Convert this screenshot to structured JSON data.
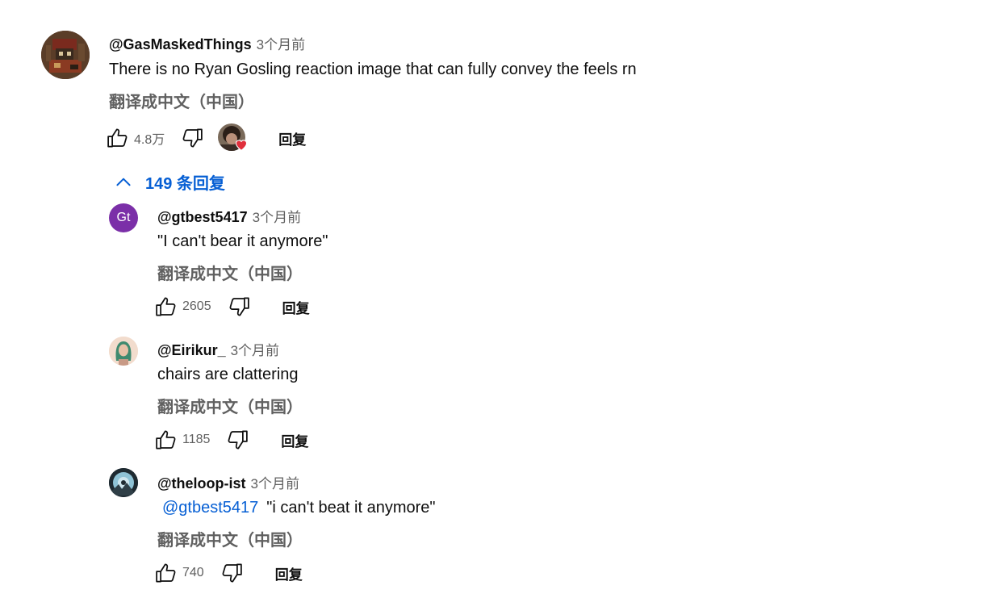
{
  "top_comment": {
    "author": "@GasMaskedThings",
    "time": "3个月前",
    "text": "There is no Ryan Gosling reaction image that can fully convey the feels rn",
    "translate": "翻译成中文（中国）",
    "likes": "4.8万",
    "reply_label": "回复",
    "creator_heart": "heart-icon"
  },
  "replies_toggle": {
    "label": "149 条回复",
    "icon": "chevron-up-icon"
  },
  "replies": [
    {
      "author": "@gtbest5417",
      "avatar_initials": "Gt",
      "avatar_color": "#7b2fa8",
      "time": "3个月前",
      "text": "\"I can't bear it anymore\"",
      "translate": "翻译成中文（中国）",
      "likes": "2605",
      "reply_label": "回复"
    },
    {
      "author": "@Eirikur_",
      "time": "3个月前",
      "text": "chairs are clattering",
      "translate": "翻译成中文（中国）",
      "likes": "1185",
      "reply_label": "回复"
    },
    {
      "author": "@theloop-ist",
      "time": "3个月前",
      "mention": "@gtbest5417",
      "text": "\"i can't beat it anymore\"",
      "translate": "翻译成中文（中国）",
      "likes": "740",
      "reply_label": "回复"
    }
  ],
  "colors": {
    "link": "#065fd4",
    "secondary": "#606060",
    "heart": "#e02f3c"
  }
}
